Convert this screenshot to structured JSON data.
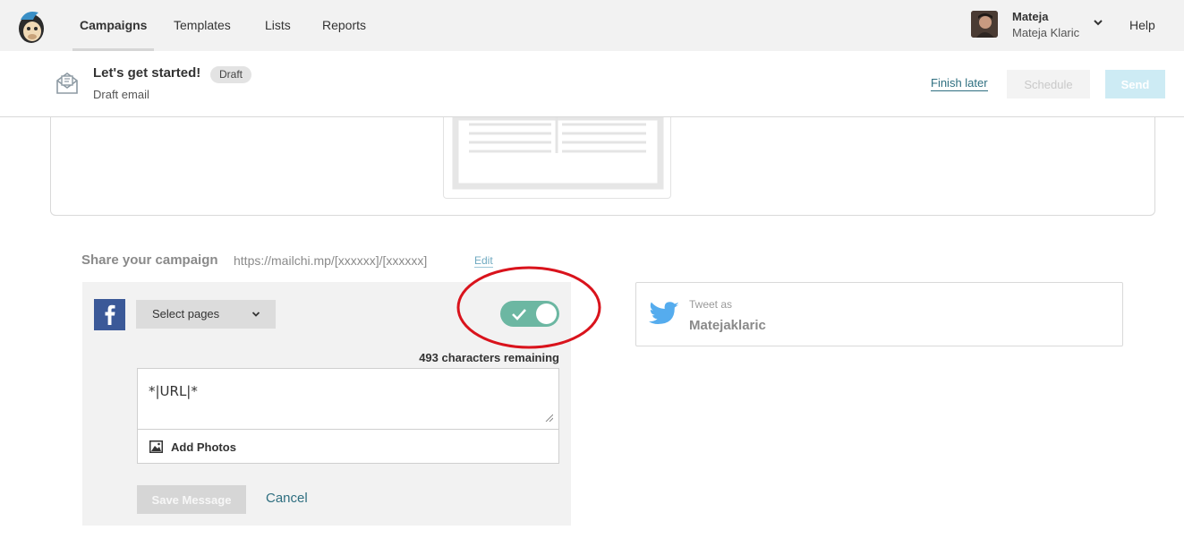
{
  "nav": {
    "items": [
      {
        "label": "Campaigns",
        "active": true
      },
      {
        "label": "Templates",
        "active": false
      },
      {
        "label": "Lists",
        "active": false
      },
      {
        "label": "Reports",
        "active": false
      }
    ],
    "user": {
      "name": "Mateja",
      "full_name": "Mateja Klaric"
    },
    "help": "Help"
  },
  "header": {
    "title": "Let's get started!",
    "badge": "Draft",
    "subtitle": "Draft email",
    "finish_later": "Finish later",
    "schedule": "Schedule",
    "send": "Send"
  },
  "share": {
    "label": "Share your campaign",
    "url": "https://mailchi.mp/[xxxxxx]/[xxxxxx]",
    "edit": "Edit"
  },
  "facebook": {
    "select_pages": "Select pages",
    "toggle_on": true,
    "chars_remaining": "493 characters remaining",
    "message": "*|URL|*",
    "add_photos": "Add Photos",
    "save": "Save Message",
    "cancel": "Cancel"
  },
  "twitter": {
    "label": "Tweet as",
    "user": "Matejaklaric"
  },
  "colors": {
    "facebook": "#3b5998",
    "toggle": "#6cb7a2",
    "twitter": "#55acee",
    "link": "#2f6f80",
    "annotation": "#d9131c"
  }
}
